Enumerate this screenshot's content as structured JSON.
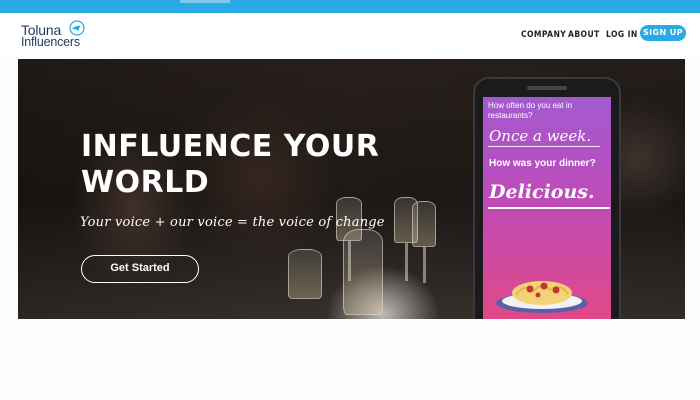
{
  "brand": {
    "line1": "Toluna",
    "line2": "Influencers",
    "icon": "bird-icon",
    "color": "#1e3a5f"
  },
  "nav": {
    "company": "COMPANY",
    "about": "ABOUT",
    "login": "LOG IN",
    "signup": "SIGN UP"
  },
  "hero": {
    "headline": "INFLUENCE YOUR WORLD",
    "tagline": "Your voice + our voice = the voice of change",
    "cta": "Get Started"
  },
  "phone": {
    "question1": "How often do you eat in restaurants?",
    "answer1": "Once a week.",
    "question2": "How was your dinner?",
    "answer2": "Delicious.",
    "illustration": "spaghetti-plate-icon"
  },
  "colors": {
    "accent": "#29a9e6",
    "screen_top": "#a35ad0",
    "screen_bottom": "#e6497f"
  }
}
